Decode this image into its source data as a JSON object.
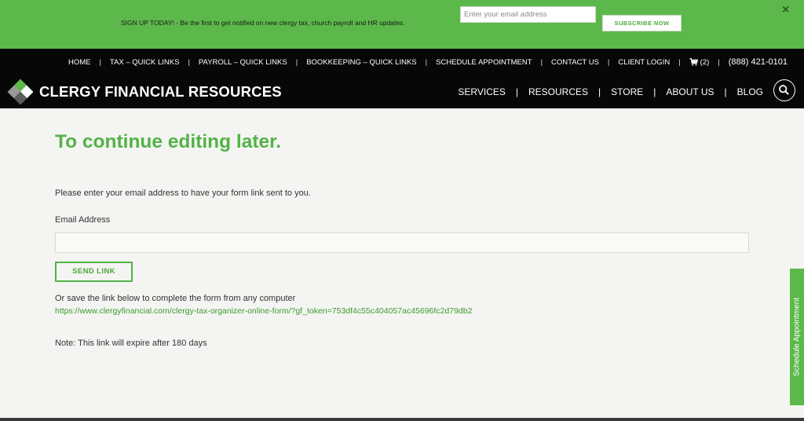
{
  "promo": {
    "text": "SIGN UP TODAY! - Be the first to get notified on new clergy tax, church payroll and HR updates.",
    "email_placeholder": "Enter your email address",
    "subscribe_label": "SUBSCRIBE NOW",
    "close_icon": "×"
  },
  "topnav": {
    "items": [
      "HOME",
      "TAX – QUICK LINKS",
      "PAYROLL – QUICK LINKS",
      "BOOKKEEPING – QUICK LINKS",
      "SCHEDULE APPOINTMENT",
      "CONTACT US",
      "CLIENT LOGIN"
    ],
    "cart_count": "(2)",
    "phone": "(888) 421-0101"
  },
  "brand": {
    "name": "CLERGY FINANCIAL RESOURCES"
  },
  "mainnav": {
    "items": [
      "SERVICES",
      "RESOURCES",
      "STORE",
      "ABOUT US",
      "BLOG"
    ]
  },
  "content": {
    "title": "To continue editing later.",
    "instructions": "Please enter your email address to have your form link sent to you.",
    "email_label": "Email Address",
    "email_value": "",
    "send_label": "SEND LINK",
    "save_text": "Or save the link below to complete the form from any computer",
    "save_link": "https://www.clergyfinancial.com/clergy-tax-organizer-online-form/?gf_token=753df4c55c404057ac45696fc2d79db2",
    "note": "Note: This link will expire after 180 days"
  },
  "side_tab": {
    "label": "Schedule Appointment"
  },
  "icons": {
    "cart": "cart-icon",
    "search": "search-icon",
    "close": "close-icon",
    "logo": "logo-diamond-mark"
  },
  "colors": {
    "brand_green": "#5cb84a",
    "title_green": "#53b246",
    "header_black": "#070707",
    "page_bg": "#f4f5f2"
  }
}
